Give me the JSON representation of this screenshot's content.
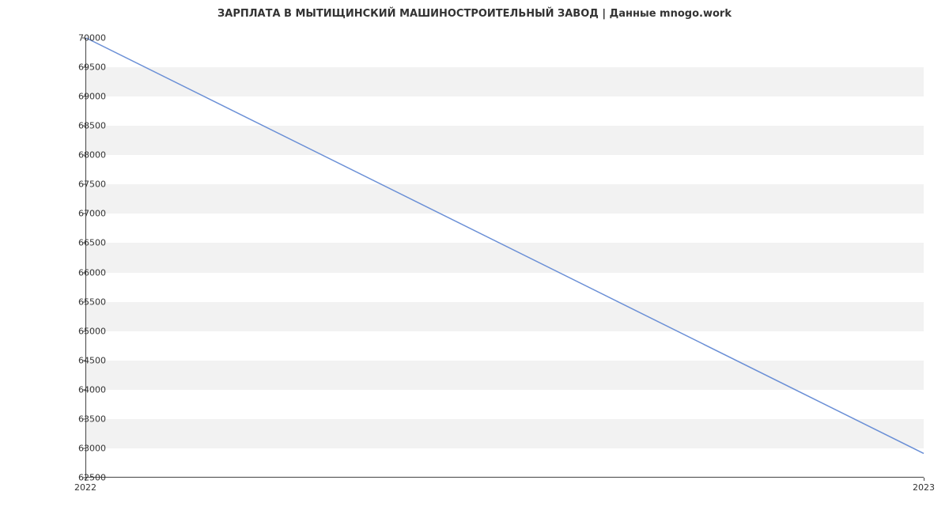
{
  "chart_data": {
    "type": "line",
    "title": "ЗАРПЛАТА В   МЫТИЩИНСКИЙ МАШИНОСТРОИТЕЛЬНЫЙ ЗАВОД | Данные mnogo.work",
    "x": [
      2022,
      2023
    ],
    "values": [
      70000,
      62900
    ],
    "xlabel": "",
    "ylabel": "",
    "xlim": [
      2022,
      2023
    ],
    "ylim": [
      62500,
      70000
    ],
    "yticks": [
      62500,
      63000,
      63500,
      64000,
      64500,
      65000,
      65500,
      66000,
      66500,
      67000,
      67500,
      68000,
      68500,
      69000,
      69500,
      70000
    ],
    "xticks": [
      2022,
      2023
    ],
    "line_color": "#6a8fd6",
    "band_color": "#f2f2f2"
  }
}
